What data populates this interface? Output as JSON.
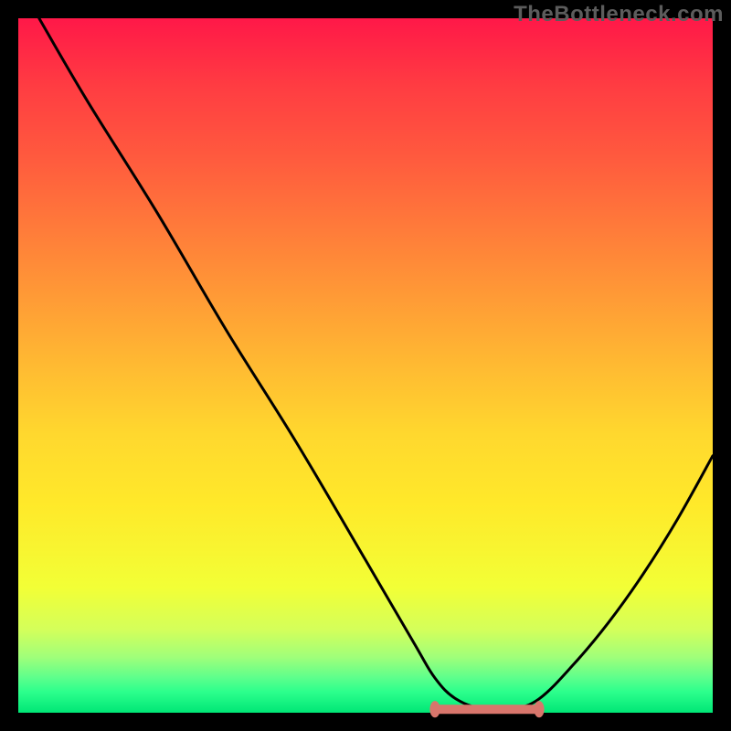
{
  "watermark": "TheBottleneck.com",
  "colors": {
    "curve": "#000000",
    "optimal_marker": "#d8766c",
    "gradient_top": "#ff1848",
    "gradient_bottom": "#00e676",
    "background": "#000000"
  },
  "chart_data": {
    "type": "line",
    "title": "",
    "xlabel": "",
    "ylabel": "",
    "xlim": [
      0,
      100
    ],
    "ylim": [
      0,
      100
    ],
    "grid": false,
    "series": [
      {
        "name": "bottleneck-curve",
        "x": [
          3,
          10,
          20,
          30,
          40,
          50,
          57,
          60,
          63,
          67,
          71,
          75,
          80,
          85,
          90,
          95,
          100
        ],
        "y": [
          100,
          88,
          72,
          55,
          39,
          22,
          10,
          5,
          2,
          0.5,
          0.5,
          2,
          7,
          13,
          20,
          28,
          37
        ]
      }
    ],
    "optimal_band": {
      "x_start": 60,
      "x_end": 75,
      "y": 0.5
    },
    "annotations": []
  }
}
